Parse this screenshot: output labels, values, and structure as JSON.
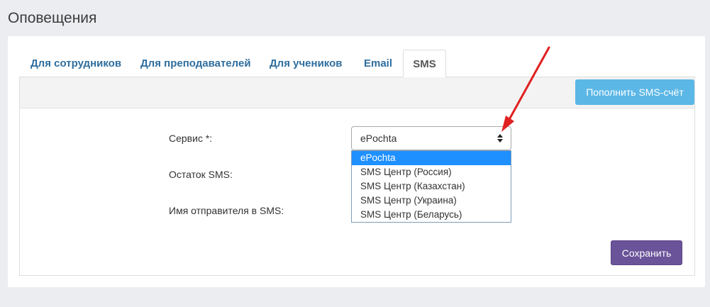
{
  "page": {
    "title": "Оповещения"
  },
  "tabs": [
    {
      "label": "Для сотрудников"
    },
    {
      "label": "Для преподавателей"
    },
    {
      "label": "Для учеников"
    },
    {
      "label": "Email"
    },
    {
      "label": "SMS"
    }
  ],
  "toolbar": {
    "topup_label": "Пополнить SMS-счёт",
    "topup_color": "#5bb7e6"
  },
  "form": {
    "service_label": "Сервис *:",
    "balance_label": "Остаток SMS:",
    "sender_label": "Имя отправителя в SMS:",
    "service_value": "ePochta",
    "options": [
      "ePochta",
      "SMS Центр (Россия)",
      "SMS Центр (Казахстан)",
      "SMS Центр (Украина)",
      "SMS Центр (Беларусь)"
    ],
    "save_label": "Сохранить",
    "save_color": "#6a5399"
  },
  "annotation": {
    "arrow_color": "#e02020"
  }
}
